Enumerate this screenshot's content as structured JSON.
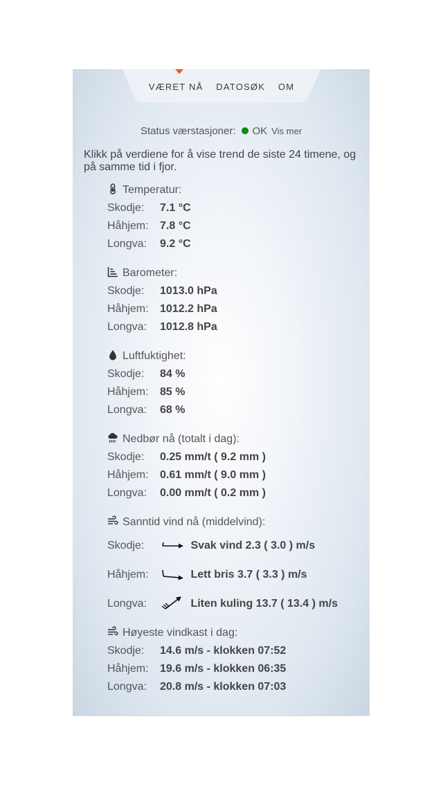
{
  "nav": {
    "items": [
      "VÆRET NÅ",
      "DATOSØK",
      "OM"
    ]
  },
  "status": {
    "label": "Status værstasjoner:",
    "state": "OK",
    "more": "Vis mer",
    "dot_color": "#0a8a1a"
  },
  "intro": "Klikk på verdiene for å vise trend de siste 24 timene, og på samme tid i fjor.",
  "temperature": {
    "title": "Temperatur:",
    "icon": "thermometer-icon",
    "rows": [
      {
        "name": "Skodje:",
        "value": "7.1 °C"
      },
      {
        "name": "Håhjem:",
        "value": "7.8 °C"
      },
      {
        "name": "Longva:",
        "value": "9.2 °C"
      }
    ]
  },
  "barometer": {
    "title": "Barometer:",
    "icon": "chart-bars-icon",
    "rows": [
      {
        "name": "Skodje:",
        "value": "1013.0 hPa"
      },
      {
        "name": "Håhjem:",
        "value": "1012.2 hPa"
      },
      {
        "name": "Longva:",
        "value": "1012.8 hPa"
      }
    ]
  },
  "humidity": {
    "title": "Luftfuktighet:",
    "icon": "droplet-icon",
    "rows": [
      {
        "name": "Skodje:",
        "value": "84 %"
      },
      {
        "name": "Håhjem:",
        "value": "85 %"
      },
      {
        "name": "Longva:",
        "value": "68 %"
      }
    ]
  },
  "precip": {
    "title": "Nedbør nå (totalt i dag):",
    "icon": "rain-cloud-icon",
    "rows": [
      {
        "name": "Skodje:",
        "value": "0.25 mm/t ( 9.2 mm )"
      },
      {
        "name": "Håhjem:",
        "value": "0.61 mm/t ( 9.0 mm )"
      },
      {
        "name": "Longva:",
        "value": "0.00 mm/t ( 0.2 mm )"
      }
    ]
  },
  "wind": {
    "title": "Sanntid vind nå (middelvind):",
    "icon": "wind-icon",
    "rows": [
      {
        "name": "Skodje:",
        "value": "Svak vind  2.3 ( 3.0 ) m/s",
        "arrow": "wind-barb-light-icon"
      },
      {
        "name": "Håhjem:",
        "value": "Lett bris  3.7 ( 3.3 ) m/s",
        "arrow": "wind-barb-breeze-icon"
      },
      {
        "name": "Longva:",
        "value": "Liten kuling  13.7 ( 13.4 ) m/s",
        "arrow": "wind-barb-gale-icon"
      }
    ]
  },
  "gust": {
    "title": "Høyeste vindkast i dag:",
    "icon": "wind-icon",
    "rows": [
      {
        "name": "Skodje:",
        "value": "14.6 m/s - klokken 07:52"
      },
      {
        "name": "Håhjem:",
        "value": "19.6 m/s - klokken 06:35"
      },
      {
        "name": "Longva:",
        "value": "20.8 m/s - klokken 07:03"
      }
    ]
  }
}
